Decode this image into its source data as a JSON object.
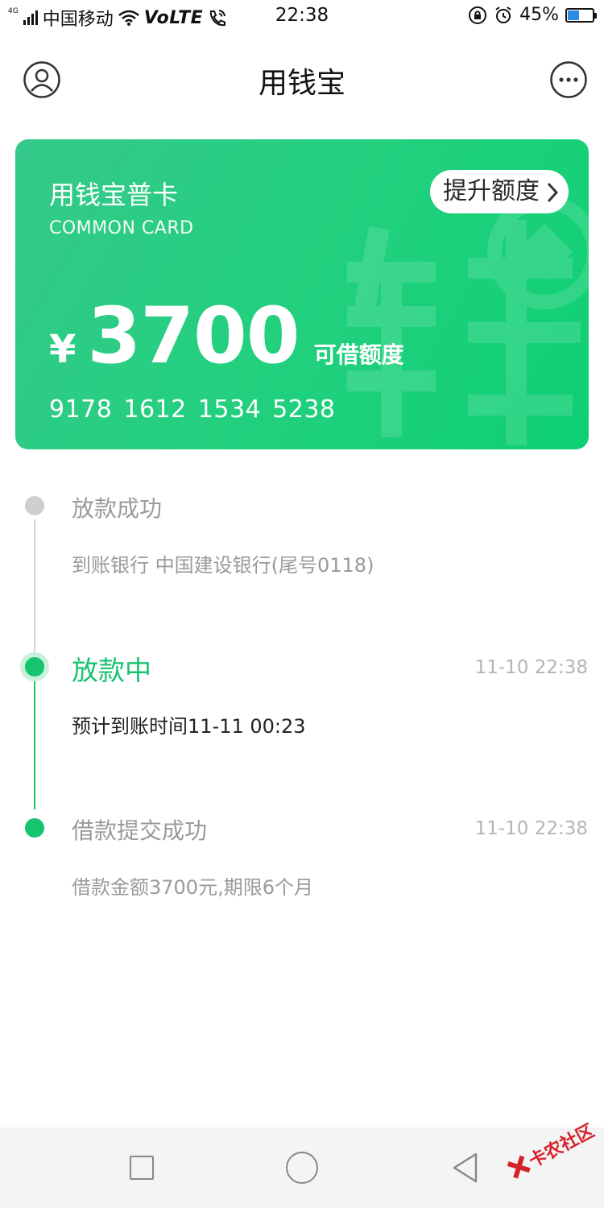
{
  "status_bar": {
    "network_type": "4G",
    "carrier": "中国移动",
    "volte": "VoLTE",
    "time": "22:38",
    "battery": "45%",
    "battery_level": 0.45
  },
  "header": {
    "title": "用钱宝",
    "icons": {
      "left": "profile-icon",
      "right": "more-icon"
    }
  },
  "card": {
    "name": "用钱宝普卡",
    "subtitle": "COMMON CARD",
    "upgrade_label": "提升额度",
    "currency": "¥",
    "amount": "3700",
    "amount_label": "可借额度",
    "number": "9178  1612  1534  5238",
    "watermark_char": "钱",
    "colors": {
      "start": "#35c98a",
      "end": "#0ecf73"
    }
  },
  "timeline": {
    "steps": [
      {
        "title": "放款成功",
        "time": "",
        "desc": "到账银行 中国建设银行(尾号0118)"
      },
      {
        "title": "放款中",
        "time": "11-10 22:38",
        "desc": "预计到账时间11-11 00:23"
      },
      {
        "title": "借款提交成功",
        "time": "11-10 22:38",
        "desc": "借款金额3700元,期限6个月"
      }
    ],
    "colors": {
      "active": "#16c46e",
      "inactive": "#cfcfcf",
      "muted_text": "#9a9a9a"
    }
  },
  "nav": {
    "icons": [
      "recent-apps-icon",
      "home-icon",
      "back-icon"
    ]
  },
  "watermark": {
    "text": "卡农社区"
  }
}
